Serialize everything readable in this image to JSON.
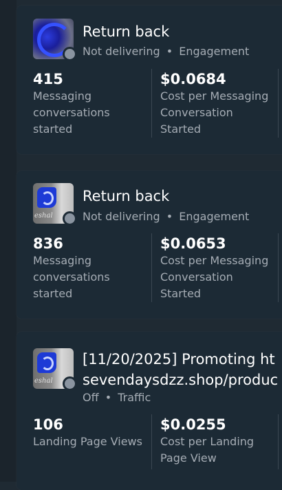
{
  "campaigns": [
    {
      "title": "Return back",
      "status": "Not delivering",
      "objective": "Engagement",
      "separator": "•",
      "thumbnail_icon": "blue-swirl-thumbnail",
      "metrics": [
        {
          "value": "415",
          "label": "Messaging\nconversations\nstarted"
        },
        {
          "value": "$0.0684",
          "label": "Cost per Messaging\nConversation\nStarted"
        }
      ]
    },
    {
      "title": "Return back",
      "status": "Not delivering",
      "objective": "Engagement",
      "separator": "•",
      "thumbnail_icon": "blue-logo-thumbnail",
      "metrics": [
        {
          "value": "836",
          "label": "Messaging\nconversations\nstarted"
        },
        {
          "value": "$0.0653",
          "label": "Cost per Messaging\nConversation\nStarted"
        }
      ]
    },
    {
      "title": "[11/20/2025] Promoting ht",
      "title_line2": "sevendaysdzz.shop/produc",
      "status": "Off",
      "objective": "Traffic",
      "separator": "•",
      "thumbnail_icon": "blue-logo-thumbnail",
      "metrics": [
        {
          "value": "106",
          "label": "Landing Page Views"
        },
        {
          "value": "$0.0255",
          "label": "Cost per Landing\nPage View"
        }
      ]
    }
  ],
  "colors": {
    "background": "#1f2a33",
    "card": "#1c2a35",
    "status_dot": "#8a94a0",
    "muted_text": "#a6adb5"
  }
}
